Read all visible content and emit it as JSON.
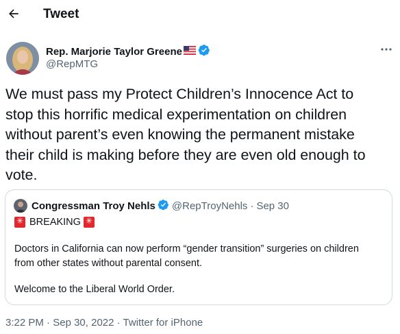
{
  "header": {
    "title": "Tweet"
  },
  "author": {
    "name": "Rep. Marjorie Taylor Greene",
    "handle": "@RepMTG",
    "verified": true
  },
  "tweet": {
    "text": "We must pass my Protect Children’s Innocence Act to\nstop this horrific medical experimentation on children\nwithout parent’s even knowing the permanent mistake\ntheir child is making before they are even old enough to\nvote."
  },
  "quoted_tweet": {
    "name": "Congressman Troy Nehls",
    "handle": "@RepTroyNehls",
    "separator": "·",
    "date": "Sep 30",
    "breaking": "BREAKING",
    "body_line1": "Doctors in California can now perform “gender transition” surgeries on children",
    "body_line2": "from other states without parental consent.",
    "body_line3": "Welcome to the Liberal World Order."
  },
  "meta": {
    "time": "3:22 PM",
    "date": "Sep 30, 2022",
    "source": "Twitter for iPhone",
    "separator": "·"
  },
  "colors": {
    "text": "#0f1419",
    "secondary": "#536471",
    "verified": "#1d9bf0",
    "border": "#cfd9de",
    "siren": "#e0282e"
  },
  "icons": {
    "back": "arrow-left-icon",
    "verified": "verified-badge-icon",
    "more": "more-dots-icon",
    "flag": "us-flag-icon",
    "siren": "rotating-light-icon"
  }
}
